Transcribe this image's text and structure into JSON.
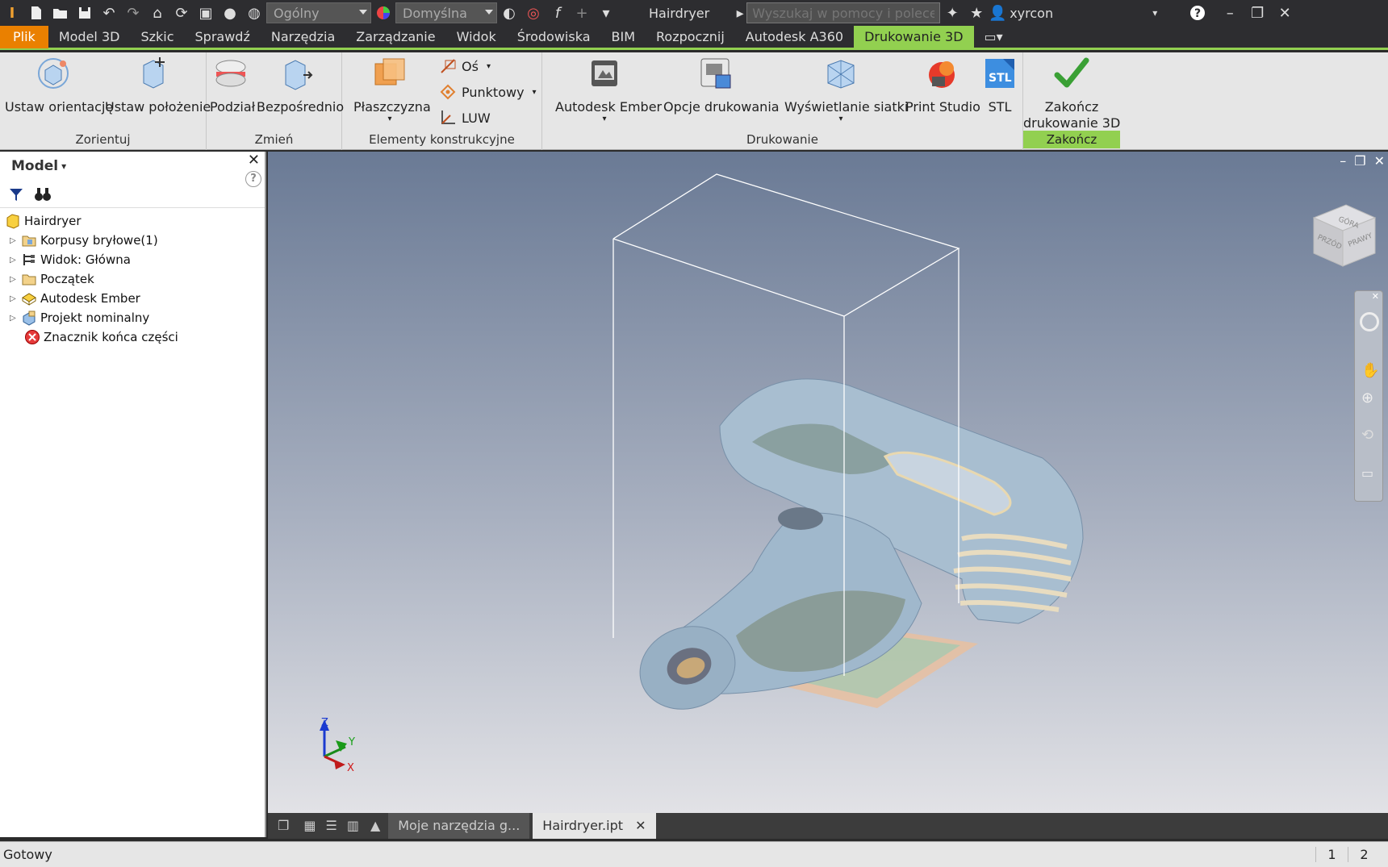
{
  "titlebar": {
    "style_combo": "Ogólny",
    "appearance_combo": "Domyślna",
    "doc_title": "Hairdryer",
    "search_placeholder": "Wyszukaj w pomocy i polecenia",
    "user": "xyrcon"
  },
  "menu": {
    "items": [
      "Plik",
      "Model 3D",
      "Szkic",
      "Sprawdź",
      "Narzędzia",
      "Zarządzanie",
      "Widok",
      "Środowiska",
      "BIM",
      "Rozpocznij",
      "Autodesk A360",
      "Drukowanie 3D"
    ]
  },
  "ribbon": {
    "orient": {
      "label": "Zorientuj",
      "set_orientation": "Ustaw orientację",
      "set_position": "Ustaw położenie"
    },
    "modify": {
      "label": "Zmień",
      "split": "Podział",
      "direct": "Bezpośrednio"
    },
    "work": {
      "label": "Elementy konstrukcyjne",
      "plane": "Płaszczyzna",
      "axis": "Oś",
      "point": "Punktowy",
      "ucs": "LUW"
    },
    "print": {
      "label": "Drukowanie",
      "ember": "Autodesk Ember",
      "options": "Opcje drukowania",
      "mesh": "Wyświetlanie siatki",
      "studio": "Print Studio",
      "stl": "STL"
    },
    "finish": {
      "label": "Zakończ",
      "finish_line1": "Zakończ",
      "finish_line2": "drukowanie 3D"
    }
  },
  "browser": {
    "title": "Model",
    "items": [
      "Hairdryer",
      "Korpusy bryłowe(1)",
      "Widok: Główna",
      "Początek",
      "Autodesk Ember",
      "Projekt nominalny",
      "Znacznik końca części"
    ]
  },
  "viewcube": {
    "top": "GÓRA",
    "front": "PRZÓD",
    "right": "PRAWY"
  },
  "triad": {
    "x": "X",
    "y": "Y",
    "z": "Z"
  },
  "tabs": {
    "tab1": "Moje narzędzia g...",
    "tab2": "Hairdryer.ipt"
  },
  "status": {
    "text": "Gotowy",
    "n1": "1",
    "n2": "2"
  },
  "colors": {
    "accent": "#92d050",
    "file": "#ea8000"
  }
}
